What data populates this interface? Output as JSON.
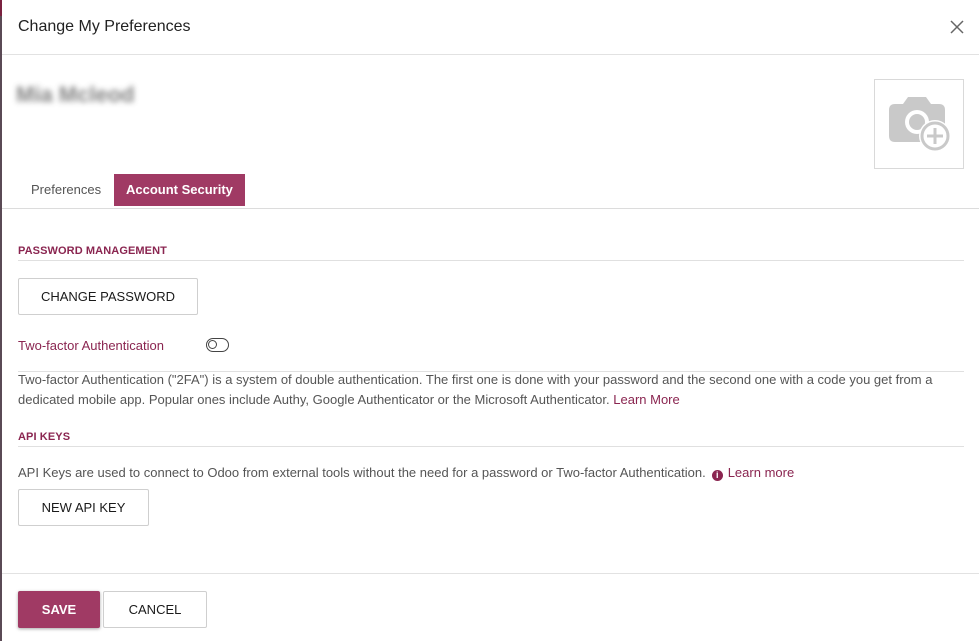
{
  "dialog": {
    "title": "Change My Preferences",
    "user_name": "Mia Mcleod"
  },
  "tabs": {
    "preferences": "Preferences",
    "account_security": "Account Security",
    "active": "account_security"
  },
  "password_management": {
    "heading": "PASSWORD MANAGEMENT",
    "change_password_label": "CHANGE PASSWORD",
    "two_factor_label": "Two-factor Authentication",
    "two_factor_enabled": false,
    "two_factor_description": "Two-factor Authentication (\"2FA\") is a system of double authentication. The first one is done with your password and the second one with a code you get from a dedicated mobile app. Popular ones include Authy, Google Authenticator or the Microsoft Authenticator.",
    "learn_more_label": "Learn More"
  },
  "api_keys": {
    "heading": "API KEYS",
    "description": "API Keys are used to connect to Odoo from external tools without the need for a password or Two-factor Authentication.",
    "learn_more_label": "Learn more",
    "new_key_label": "NEW API KEY"
  },
  "footer": {
    "save_label": "SAVE",
    "cancel_label": "CANCEL"
  },
  "colors": {
    "accent": "#a03a64",
    "accent_text": "#8a2550"
  }
}
